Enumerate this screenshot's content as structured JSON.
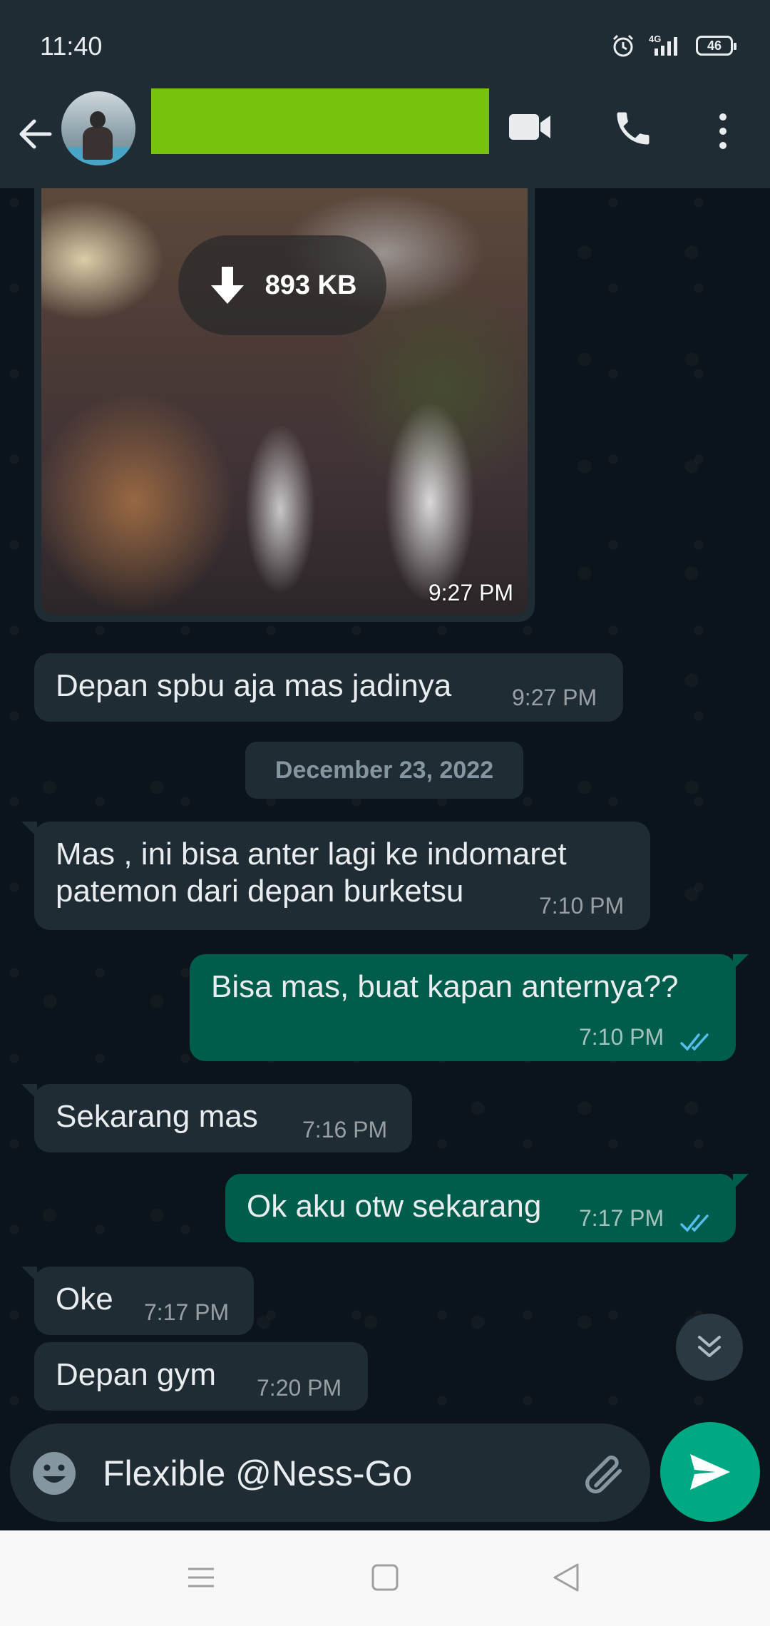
{
  "status_bar": {
    "time": "11:40",
    "network": "4G",
    "battery": "46"
  },
  "header": {
    "contact_name": ""
  },
  "messages": [
    {
      "direction": "in",
      "type": "image",
      "size": "893 KB",
      "time": "9:27 PM"
    },
    {
      "direction": "in",
      "text": "Depan spbu aja mas jadinya",
      "time": "9:27 PM"
    },
    {
      "direction": "date",
      "text": "December 23, 2022"
    },
    {
      "direction": "in",
      "text_line1": "Mas , ini bisa anter lagi ke indomaret",
      "text_line2": "patemon dari depan burketsu",
      "time": "7:10 PM"
    },
    {
      "direction": "out",
      "text": "Bisa mas, buat kapan anternya??",
      "time": "7:10 PM",
      "status": "read"
    },
    {
      "direction": "in",
      "text": "Sekarang mas",
      "time": "7:16 PM"
    },
    {
      "direction": "out",
      "text": "Ok aku otw sekarang",
      "time": "7:17 PM",
      "status": "read"
    },
    {
      "direction": "in",
      "text": "Oke",
      "time": "7:17 PM"
    },
    {
      "direction": "in",
      "text": "Depan gym",
      "time": "7:20 PM"
    }
  ],
  "composer": {
    "value": "Flexible @Ness-Go"
  },
  "colors": {
    "accent": "#00a884",
    "outgoing_bubble": "#005c4b",
    "incoming_bubble": "#1f2c34",
    "read_ticks": "#53bdeb",
    "redaction": "#76c20c"
  }
}
